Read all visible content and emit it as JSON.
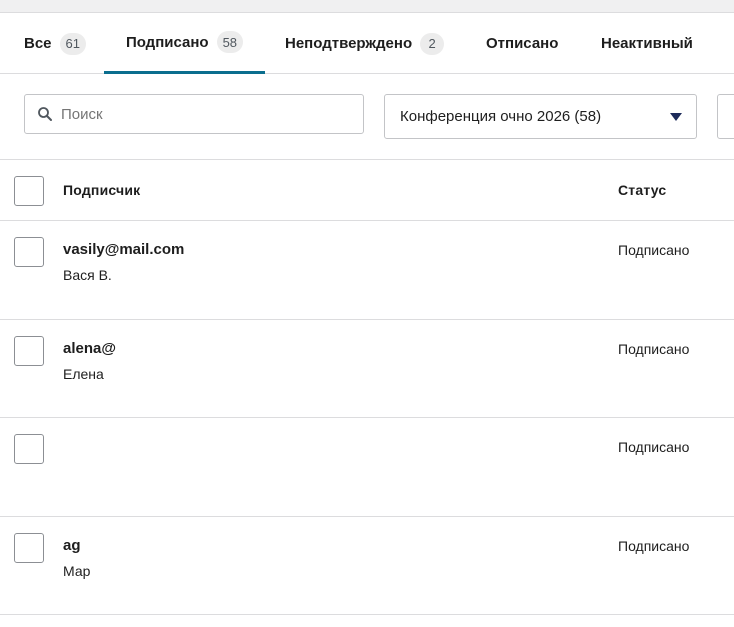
{
  "tabs": [
    {
      "label": "Все",
      "count": "61"
    },
    {
      "label": "Подписано",
      "count": "58",
      "active": true
    },
    {
      "label": "Неподтверждено",
      "count": "2"
    },
    {
      "label": "Отписано",
      "count": ""
    },
    {
      "label": "Неактивный",
      "count": ""
    }
  ],
  "filters": {
    "search_placeholder": "Поиск",
    "list_select_value": "Конференция очно 2026 (58)"
  },
  "table": {
    "headers": {
      "subscriber": "Подписчик",
      "status": "Статус"
    },
    "rows": [
      {
        "email": "vasily@mail.com",
        "name": "Вася В.",
        "status": "Подписано"
      },
      {
        "email": "alena@",
        "name": "Елена",
        "status": "Подписано"
      },
      {
        "email": "",
        "name": "",
        "status": "Подписано"
      },
      {
        "email": "ag",
        "name": "Мар",
        "status": "Подписано"
      }
    ]
  },
  "colors": {
    "accent": "#0b6e8e",
    "border": "#dcdcde",
    "arrow": "#1d2b5a"
  }
}
